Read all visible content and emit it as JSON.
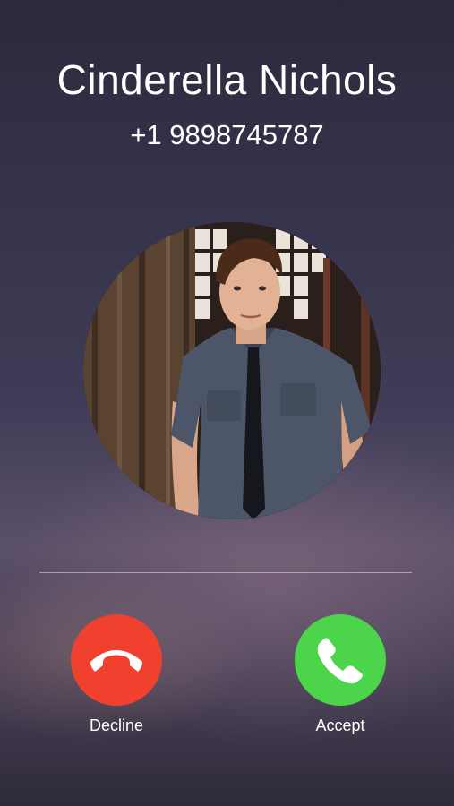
{
  "call": {
    "caller_name": "Cinderella Nichols",
    "phone_number": "+1 9898745787"
  },
  "actions": {
    "decline_label": "Decline",
    "accept_label": "Accept"
  },
  "icons": {
    "decline": "phone-hangup-icon",
    "accept": "phone-icon"
  },
  "colors": {
    "decline": "#f0412f",
    "accept": "#4cd44a",
    "text": "#ffffff"
  }
}
